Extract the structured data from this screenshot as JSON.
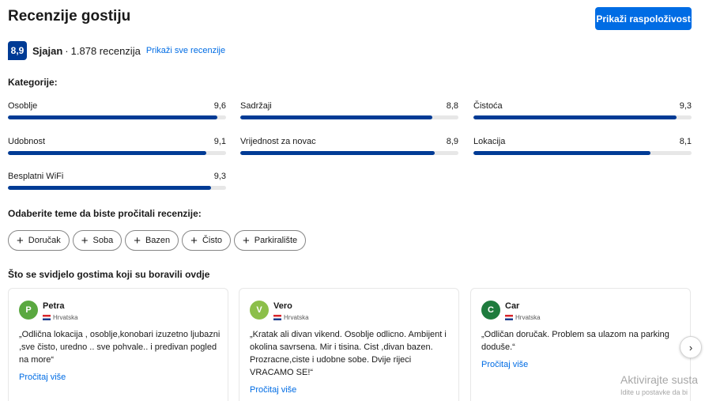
{
  "header": {
    "title": "Recenzije gostiju",
    "availability_button": "Prikaži raspoloživost"
  },
  "score": {
    "value": "8,9",
    "label": "Sjajan",
    "separator": "·",
    "count_text": "1.878 recenzija",
    "link": "Prikaži sve recenzije"
  },
  "categories": {
    "heading": "Kategorije:",
    "items": [
      {
        "label": "Osoblje",
        "score": "9,6",
        "value": 9.6
      },
      {
        "label": "Sadržaji",
        "score": "8,8",
        "value": 8.8
      },
      {
        "label": "Čistoća",
        "score": "9,3",
        "value": 9.3
      },
      {
        "label": "Udobnost",
        "score": "9,1",
        "value": 9.1
      },
      {
        "label": "Vrijednost za novac",
        "score": "8,9",
        "value": 8.9
      },
      {
        "label": "Lokacija",
        "score": "8,1",
        "value": 8.1
      },
      {
        "label": "Besplatni WiFi",
        "score": "9,3",
        "value": 9.3
      }
    ],
    "max": 10,
    "bar_color": "#003b95"
  },
  "topics": {
    "heading": "Odaberite teme da biste pročitali recenzije:",
    "chips": [
      "Doručak",
      "Soba",
      "Bazen",
      "Čisto",
      "Parkiralište"
    ]
  },
  "liked": {
    "heading": "Što se svidjelo gostima koji su boravili ovdje",
    "reviews": [
      {
        "initial": "P",
        "name": "Petra",
        "country": "Hrvatska",
        "color": "#5aa840",
        "text": "„Odlična lokacija , osoblje,konobari izuzetno ljubazni ,sve čisto, uredno .. sve pohvale.. i predivan pogled na more“",
        "read_more": "Pročitaj više"
      },
      {
        "initial": "V",
        "name": "Vero",
        "country": "Hrvatska",
        "color": "#8cbf4a",
        "text": "„Kratak ali divan vikend. Osoblje odlicno. Ambijent i okolina savrsena. Mir i tisina. Cist ,divan bazen. Prozracne,ciste i udobne sobe. Dvije rijeci VRACAMO SE!“",
        "read_more": "Pročitaj više"
      },
      {
        "initial": "C",
        "name": "Car",
        "country": "Hrvatska",
        "color": "#1e7b3d",
        "text": "„Odličan doručak. Problem sa ulazom na parking doduše.“",
        "read_more": "Pročitaj više"
      }
    ]
  },
  "next_arrow": "›",
  "watermark": {
    "line1": "Aktivirajte susta",
    "line2": "Idite u postavke da bi"
  }
}
